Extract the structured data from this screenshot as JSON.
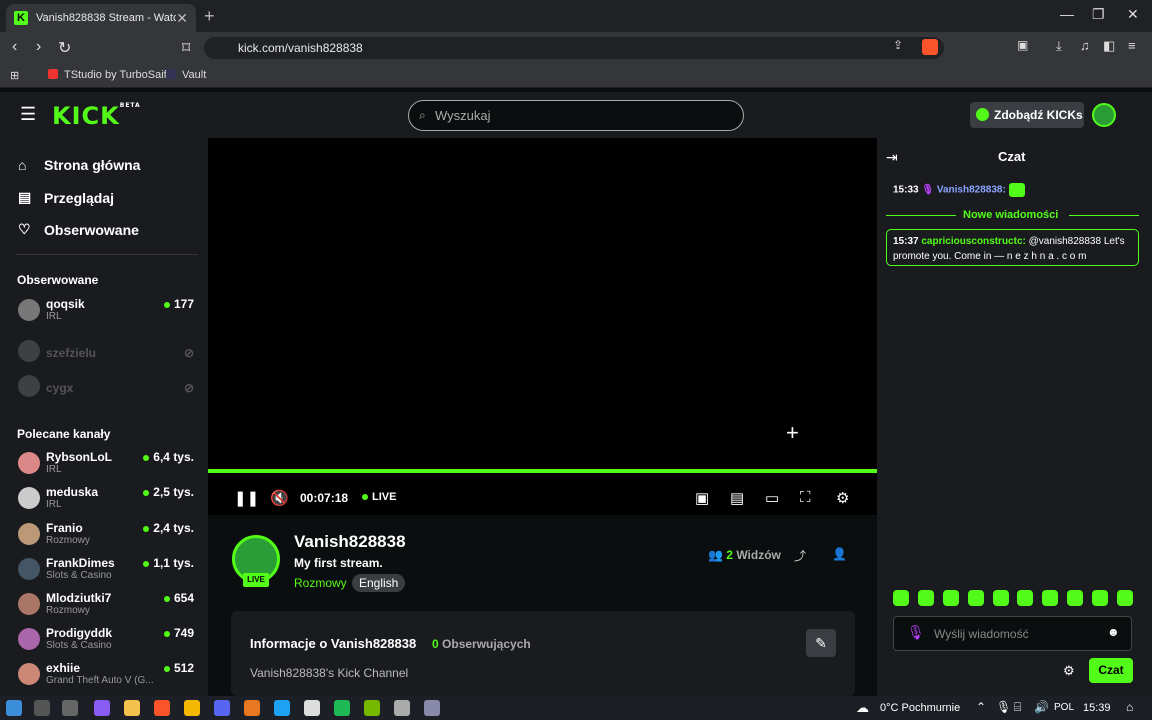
{
  "browser": {
    "tab_title": "Vanish828838 Stream - Watch Li",
    "url": "kick.com/vanish828838",
    "bookmarks": [
      "TStudio by TurboSaif",
      "Vault"
    ]
  },
  "header": {
    "search_placeholder": "Wyszukaj",
    "get_kicks": "Zdobądź KICKs"
  },
  "sidebar": {
    "menu": [
      "Strona główna",
      "Przeglądaj",
      "Obserwowane"
    ],
    "followed_title": "Obserwowane",
    "recommended_title": "Polecane kanały",
    "followed": [
      {
        "name": "qoqsik",
        "category": "IRL",
        "viewers": "177"
      },
      {
        "name": "szefzielu",
        "category": "",
        "viewers": ""
      },
      {
        "name": "cygx",
        "category": "",
        "viewers": ""
      }
    ],
    "recommended": [
      {
        "name": "RybsonLoL",
        "category": "IRL",
        "viewers": "6,4 tys."
      },
      {
        "name": "meduska",
        "category": "IRL",
        "viewers": "2,5 tys."
      },
      {
        "name": "Franio",
        "category": "Rozmowy",
        "viewers": "2,4 tys."
      },
      {
        "name": "FrankDimes",
        "category": "Slots & Casino",
        "viewers": "1,1 tys."
      },
      {
        "name": "Mlodziutki7",
        "category": "Rozmowy",
        "viewers": "654"
      },
      {
        "name": "Prodigyddk",
        "category": "Slots & Casino",
        "viewers": "749"
      },
      {
        "name": "exhiie",
        "category": "Grand Theft Auto V (G...",
        "viewers": "512"
      }
    ]
  },
  "player": {
    "time": "00:07:18",
    "live": "LIVE",
    "progress": 1.0
  },
  "channel": {
    "name": "Vanish828838",
    "title": "My first stream.",
    "category": "Rozmowy",
    "language": "English",
    "viewers_count": "2",
    "viewers_label": "Widzów",
    "live_badge": "LIVE"
  },
  "info": {
    "title": "Informacje o Vanish828838",
    "followers_count": "0",
    "followers_label": "Obserwujących",
    "description": "Vanish828838's Kick Channel"
  },
  "chat": {
    "title": "Czat",
    "msg1": {
      "time": "15:33",
      "user": "Vanish828838:"
    },
    "new_messages": "Nowe wiadomości",
    "msg2": {
      "time": "15:37",
      "user": "capriciousconstructc:",
      "text": "@vanish828838 Let's promote you. Come in — n e  z h n a . c o m"
    },
    "input_placeholder": "Wyślij wiadomość",
    "send": "Czat"
  },
  "taskbar": {
    "weather": "0°C  Pochmurnie",
    "lang": "POL",
    "time": "15:39"
  }
}
